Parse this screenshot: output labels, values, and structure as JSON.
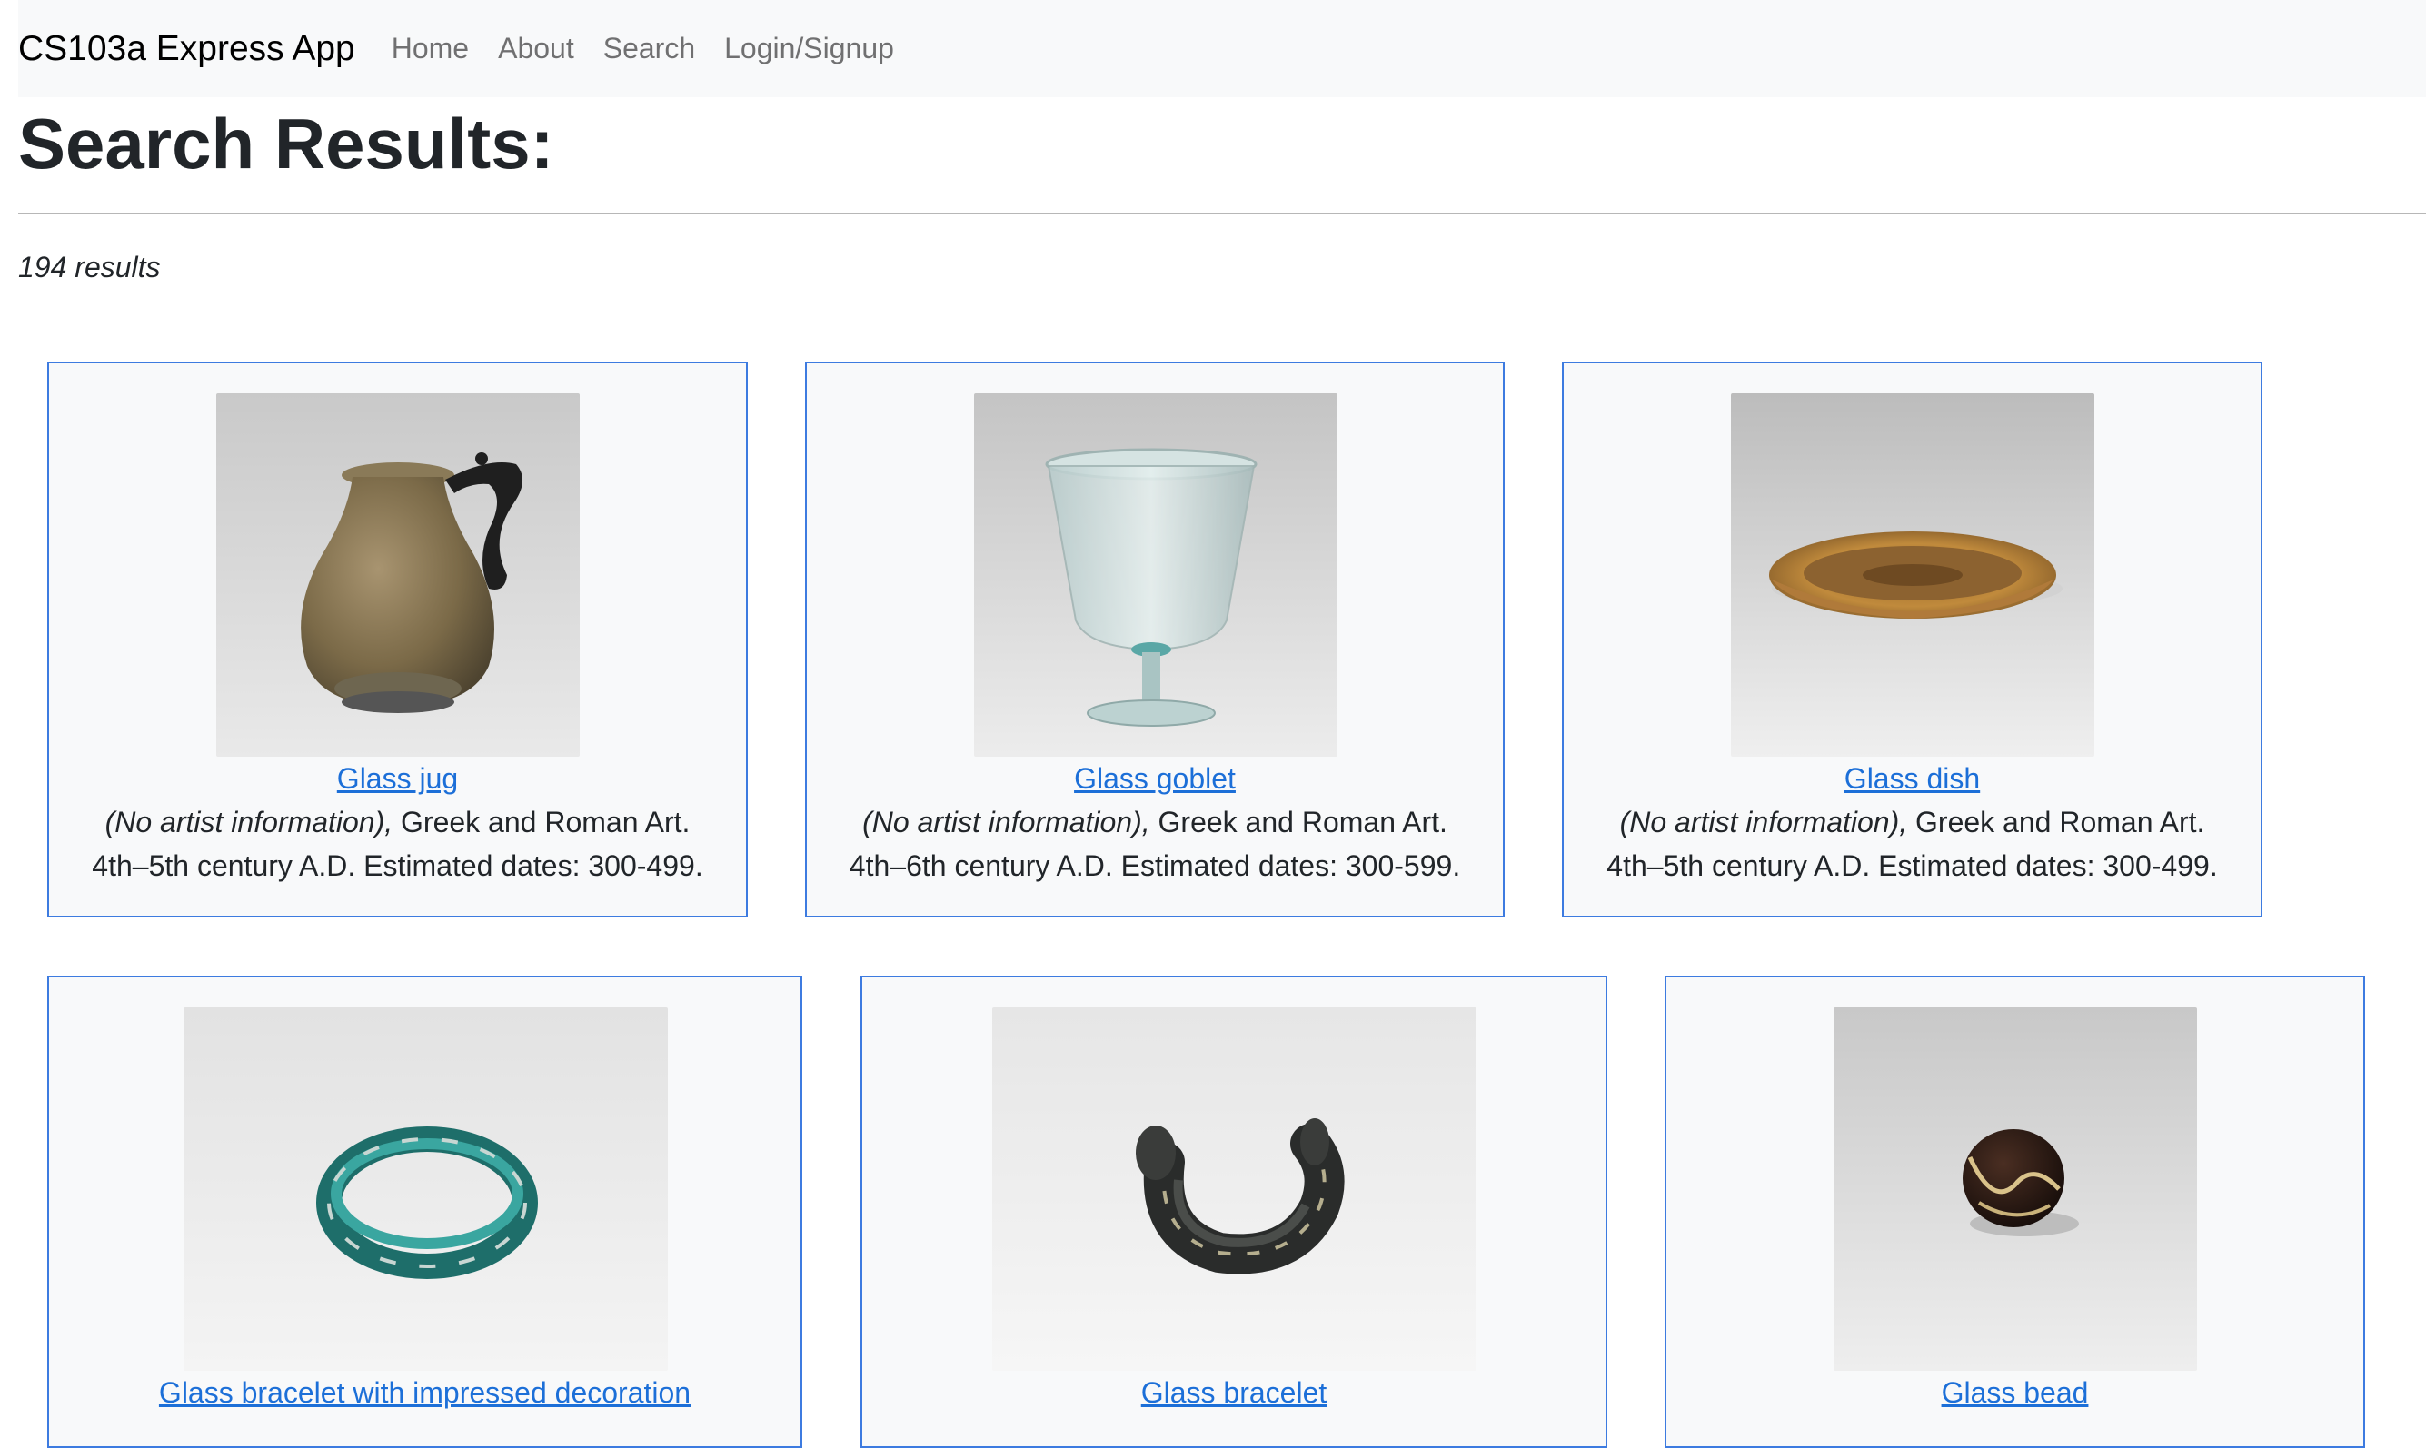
{
  "navbar": {
    "brand": "CS103a Express App",
    "links": [
      "Home",
      "About",
      "Search",
      "Login/Signup"
    ]
  },
  "page": {
    "title": "Search Results:",
    "result_count": "194 results"
  },
  "results": [
    {
      "title": "Glass jug",
      "artist": "(No artist information),",
      "department": " Greek and Roman Art.",
      "dates": "4th–5th century A.D. Estimated dates: 300-499.",
      "image_icon": "glass-jug-photo"
    },
    {
      "title": "Glass goblet",
      "artist": "(No artist information),",
      "department": " Greek and Roman Art.",
      "dates": "4th–6th century A.D. Estimated dates: 300-599.",
      "image_icon": "glass-goblet-photo"
    },
    {
      "title": "Glass dish",
      "artist": "(No artist information),",
      "department": " Greek and Roman Art.",
      "dates": "4th–5th century A.D. Estimated dates: 300-499.",
      "image_icon": "glass-dish-photo"
    },
    {
      "title": "Glass bracelet with impressed decoration",
      "image_icon": "glass-bracelet-teal-photo"
    },
    {
      "title": "Glass bracelet",
      "image_icon": "glass-bracelet-dark-photo"
    },
    {
      "title": "Glass bead",
      "image_icon": "glass-bead-photo"
    }
  ],
  "colors": {
    "navbar_bg": "#f8f9fa",
    "card_border": "#3d7be0",
    "link": "#1c6fd8"
  }
}
